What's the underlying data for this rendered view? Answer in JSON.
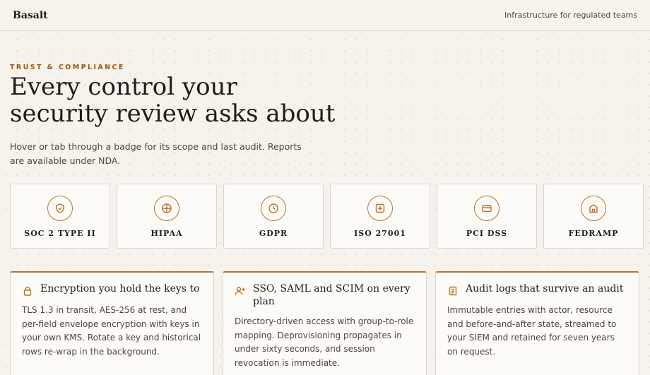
{
  "header": {
    "brand": "Basalt",
    "tagline": "Infrastructure for regulated teams"
  },
  "hero": {
    "eyebrow": "TRUST & COMPLIANCE",
    "headline_line1": "Every control your",
    "headline_line2": "security review asks about",
    "lede": "Hover or tab through a badge for its scope and last audit. Reports are available under NDA."
  },
  "badges": [
    {
      "label": "SOC 2 TYPE II",
      "icon": "shield-check-icon"
    },
    {
      "label": "HIPAA",
      "icon": "cross-circle-icon"
    },
    {
      "label": "GDPR",
      "icon": "clock-icon"
    },
    {
      "label": "ISO 27001",
      "icon": "plus-square-icon"
    },
    {
      "label": "PCI DSS",
      "icon": "credit-card-icon"
    },
    {
      "label": "FEDRAMP",
      "icon": "building-icon"
    }
  ],
  "cards": [
    {
      "title": "Encryption you hold the keys to",
      "icon": "lock-icon",
      "body": "TLS 1.3 in transit, AES-256 at rest, and per-field envelope encryption with keys in your own KMS. Rotate a key and historical rows re-wrap in the background."
    },
    {
      "title": "SSO, SAML and SCIM on every plan",
      "icon": "user-plus-icon",
      "body": "Directory-driven access with group-to-role mapping. Deprovisioning propagates in under sixty seconds, and session revocation is immediate."
    },
    {
      "title": "Audit logs that survive an audit",
      "icon": "document-icon",
      "body": "Immutable entries with actor, resource and before-and-after state, streamed to your SIEM and retained for seven years on request."
    }
  ],
  "colors": {
    "accent": "#b8732a",
    "eyebrow": "#9a5a14",
    "background": "#f6f2ec"
  }
}
